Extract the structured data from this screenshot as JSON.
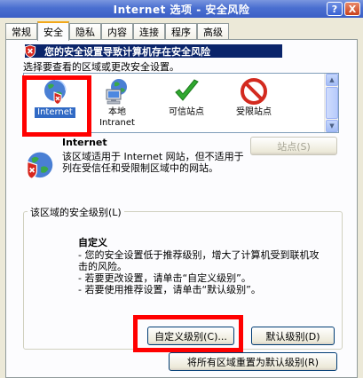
{
  "window": {
    "title": "Internet 选项 - 安全风险",
    "help_glyph": "?",
    "close_glyph": "X"
  },
  "tabs": [
    {
      "label": "常规",
      "active": false
    },
    {
      "label": "安全",
      "active": true
    },
    {
      "label": "隐私",
      "active": false
    },
    {
      "label": "内容",
      "active": false
    },
    {
      "label": "连接",
      "active": false
    },
    {
      "label": "程序",
      "active": false
    },
    {
      "label": "高级",
      "active": false
    }
  ],
  "warning": {
    "text": "您的安全设置导致计算机存在安全风险",
    "subtext": "选择要查看的区域或更改安全设置。"
  },
  "zones": [
    {
      "label": "Internet",
      "icon": "globe-warning-icon",
      "selected": true
    },
    {
      "label": "本地\nIntranet",
      "icon": "intranet-icon",
      "selected": false
    },
    {
      "label": "可信站点",
      "icon": "checkmark-icon",
      "selected": false
    },
    {
      "label": "受限站点",
      "icon": "no-entry-icon",
      "selected": false
    }
  ],
  "selected_zone": {
    "name": "Internet",
    "description": "该区域适用于 Internet 网站，但不适用于列在受信任和受限制区域中的网站。",
    "sites_button": "站点(S)"
  },
  "security_level": {
    "group_label": "该区域的安全级别(L)",
    "level_name": "自定义",
    "bullets": [
      "- 您的安全设置低于推荐级别，增大了计算机受到联机攻击的风险。",
      "- 若要更改设置，请单击“自定义级别”。",
      "- 若要使用推荐设置，请单击“默认级别”。"
    ],
    "custom_button": "自定义级别(C)...",
    "default_button": "默认级别(D)",
    "reset_all_button": "将所有区域重置为默认级别(R)"
  },
  "colors": {
    "highlight": "#ff0000",
    "warning_bar": "#0a246a",
    "selection": "#316ac5"
  }
}
